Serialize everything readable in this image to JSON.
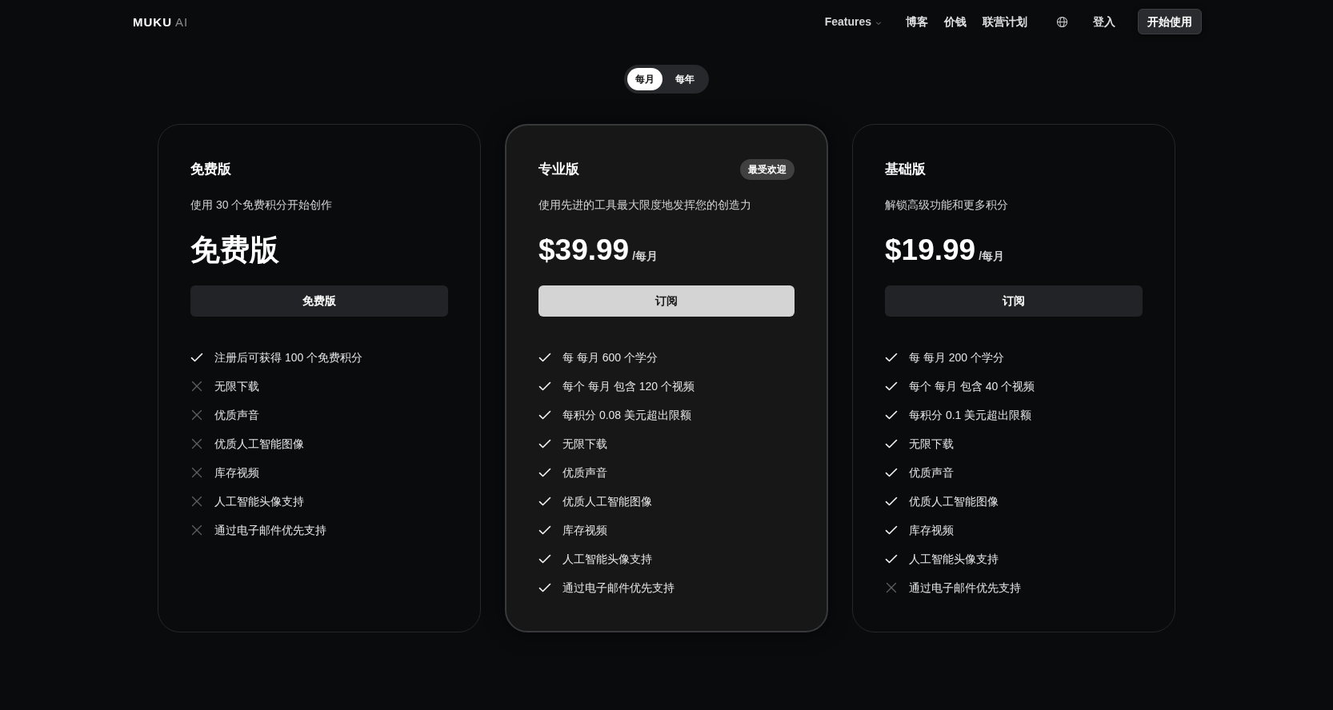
{
  "header": {
    "logo": {
      "wordmark": "MUKU",
      "suffix": "AI"
    },
    "nav": [
      {
        "label": "Features",
        "kind": "dropdown"
      },
      {
        "label": "博客",
        "kind": "link"
      },
      {
        "label": "价钱",
        "kind": "link"
      },
      {
        "label": "联营计划",
        "kind": "link"
      }
    ],
    "login": "登入",
    "cta": "开始使用"
  },
  "billing_toggle": [
    {
      "label": "每月",
      "selected": true
    },
    {
      "label": "每年",
      "selected": false
    }
  ],
  "plans": [
    {
      "name": "免费版",
      "highlighted": false,
      "description": "使用 30 个免费积分开始创作",
      "price": "免费版",
      "button": "免费版",
      "features": [
        {
          "text": "注册后可获得 100 个免费积分",
          "included": true
        },
        {
          "text": "无限下载",
          "included": false
        },
        {
          "text": "优质声音",
          "included": false
        },
        {
          "text": "优质人工智能图像",
          "included": false
        },
        {
          "text": "库存视频",
          "included": false
        },
        {
          "text": "人工智能头像支持",
          "included": false
        },
        {
          "text": "通过电子邮件优先支持",
          "included": false
        }
      ]
    },
    {
      "name": "专业版",
      "badge": "最受欢迎",
      "highlighted": true,
      "description": "使用先进的工具最大限度地发挥您的创造力",
      "price": "$39.99",
      "period": "/每月",
      "button": "订阅",
      "features": [
        {
          "text": "每 每月 600 个学分",
          "included": true
        },
        {
          "text": "每个 每月 包含 120 个视频",
          "included": true
        },
        {
          "text": "每积分 0.08 美元超出限额",
          "included": true
        },
        {
          "text": "无限下载",
          "included": true
        },
        {
          "text": "优质声音",
          "included": true
        },
        {
          "text": "优质人工智能图像",
          "included": true
        },
        {
          "text": "库存视频",
          "included": true
        },
        {
          "text": "人工智能头像支持",
          "included": true
        },
        {
          "text": "通过电子邮件优先支持",
          "included": true
        }
      ]
    },
    {
      "name": "基础版",
      "highlighted": false,
      "description": "解锁高级功能和更多积分",
      "price": "$19.99",
      "period": "/每月",
      "button": "订阅",
      "features": [
        {
          "text": "每 每月 200 个学分",
          "included": true
        },
        {
          "text": "每个 每月 包含 40 个视频",
          "included": true
        },
        {
          "text": "每积分 0.1 美元超出限额",
          "included": true
        },
        {
          "text": "无限下载",
          "included": true
        },
        {
          "text": "优质声音",
          "included": true
        },
        {
          "text": "优质人工智能图像",
          "included": true
        },
        {
          "text": "库存视频",
          "included": true
        },
        {
          "text": "人工智能头像支持",
          "included": true
        },
        {
          "text": "通过电子邮件优先支持",
          "included": false
        }
      ]
    }
  ]
}
